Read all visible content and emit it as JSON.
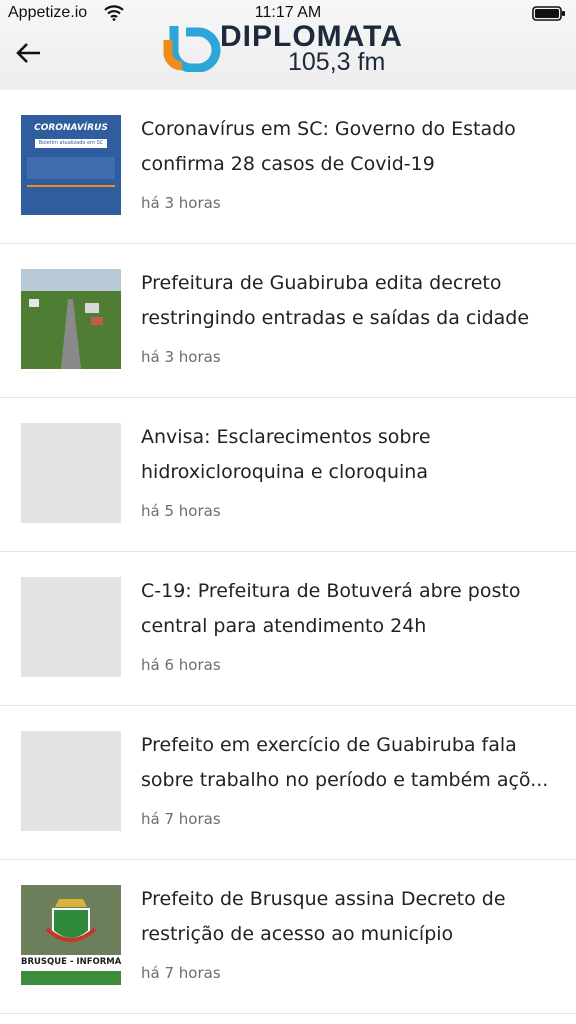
{
  "status_bar": {
    "carrier": "Appetize.io",
    "time": "11:17 AM"
  },
  "header": {
    "logo_name": "DIPLOMATA",
    "logo_frequency": "105,3 fm",
    "back_icon": "arrow-left-icon"
  },
  "articles": [
    {
      "title": "Coronavírus em SC: Governo do Estado confirma 28 casos de Covid-19",
      "time": "há 3 horas",
      "thumb_text": "CORONAVÍRUS",
      "thumb_subtext": "Boletim atualizado em SC"
    },
    {
      "title": "Prefeitura de Guabiruba edita decreto restringindo entradas e saídas da cidade",
      "time": "há 3 horas"
    },
    {
      "title": "Anvisa: Esclarecimentos sobre hidroxicloroquina e cloroquina",
      "time": "há 5 horas"
    },
    {
      "title": "C-19: Prefeitura de Botuverá abre posto central para atendimento 24h",
      "time": "há 6 horas"
    },
    {
      "title": "Prefeito em exercício de Guabiruba fala sobre trabalho no período e também açõ...",
      "time": "há 7 horas"
    },
    {
      "title": "Prefeito de Brusque assina Decreto de restrição de acesso ao município",
      "time": "há 7 horas",
      "thumb_text": "BRUSQUE - INFORMA"
    }
  ],
  "colors": {
    "logo_orange": "#f08a1c",
    "logo_blue": "#2aa7d8",
    "logo_text": "#1c2a3c",
    "covid_blue": "#2f5d9e"
  }
}
